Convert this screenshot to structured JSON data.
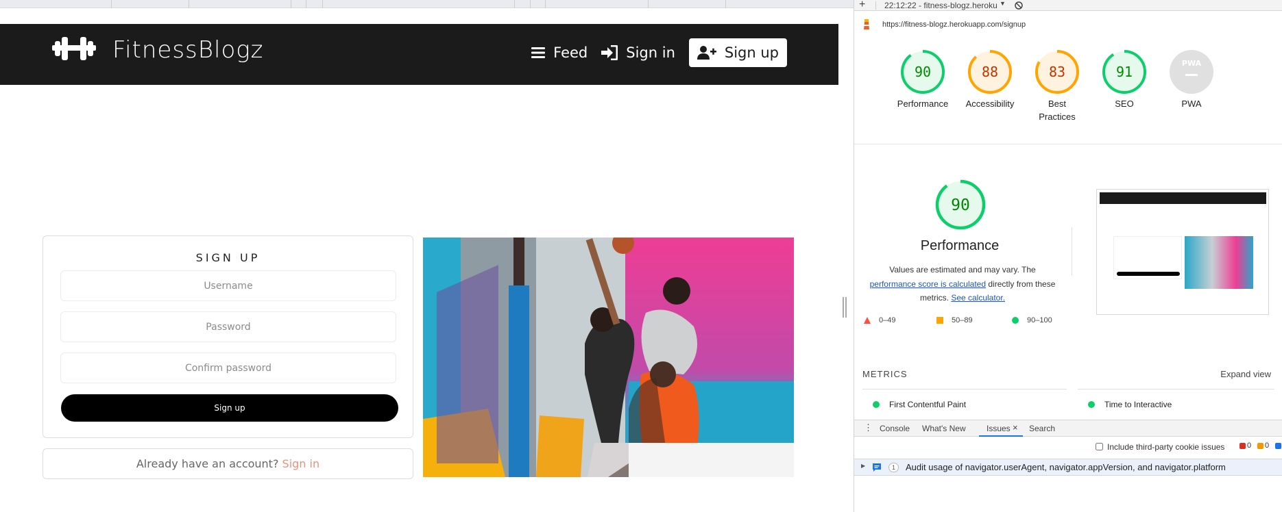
{
  "site": {
    "brand": "FitnessBlogz",
    "nav": [
      {
        "label": "Feed",
        "icon": "bars-icon"
      },
      {
        "label": "Sign in",
        "icon": "sign-in-icon"
      },
      {
        "label": "Sign up",
        "icon": "user-plus-icon"
      }
    ]
  },
  "signup": {
    "title": "SIGN UP",
    "username_placeholder": "Username",
    "password_placeholder": "Password",
    "confirm_placeholder": "Confirm password",
    "submit_label": "Sign up",
    "already_text": "Already have an account?",
    "signin_link": "Sign in"
  },
  "devtools": {
    "report_time": "22:12:22 - fitness-blogz.heroku",
    "url": "https://fitness-blogz.herokuapp.com/signup",
    "scores": [
      {
        "label": "Performance",
        "value": "90",
        "status": "pass"
      },
      {
        "label": "Accessibility",
        "value": "88",
        "status": "average"
      },
      {
        "label": "Best Practices",
        "value": "83",
        "status": "average"
      },
      {
        "label": "SEO",
        "value": "91",
        "status": "pass"
      },
      {
        "label": "PWA",
        "value": "PWA",
        "status": "na"
      }
    ],
    "perf_score": "90",
    "perf_title": "Performance",
    "perf_desc_1": "Values are estimated and may vary. The",
    "perf_link": "performance score is calculated",
    "perf_desc_2": "directly from these",
    "perf_desc_3": "metrics.",
    "calc_link": "See calculator.",
    "legend": [
      "0–49",
      "50–89",
      "90–100"
    ],
    "metrics_heading": "METRICS",
    "expand_view": "Expand view",
    "metrics": [
      "First Contentful Paint",
      "Time to Interactive"
    ],
    "drawer_tabs": [
      "Console",
      "What's New",
      "Issues",
      "Search"
    ],
    "third_party_label": "Include third-party cookie issues",
    "issue_counts": [
      "0",
      "0"
    ],
    "issue_badge": "1",
    "issue_text": "Audit usage of navigator.userAgent, navigator.appVersion, and navigator.platform"
  },
  "colors": {
    "nav_bg": "#1b1b1b",
    "pass": "#0cce6b",
    "average": "#ffa400",
    "fail": "#ff4e42",
    "signin_link": "#e8917b"
  }
}
